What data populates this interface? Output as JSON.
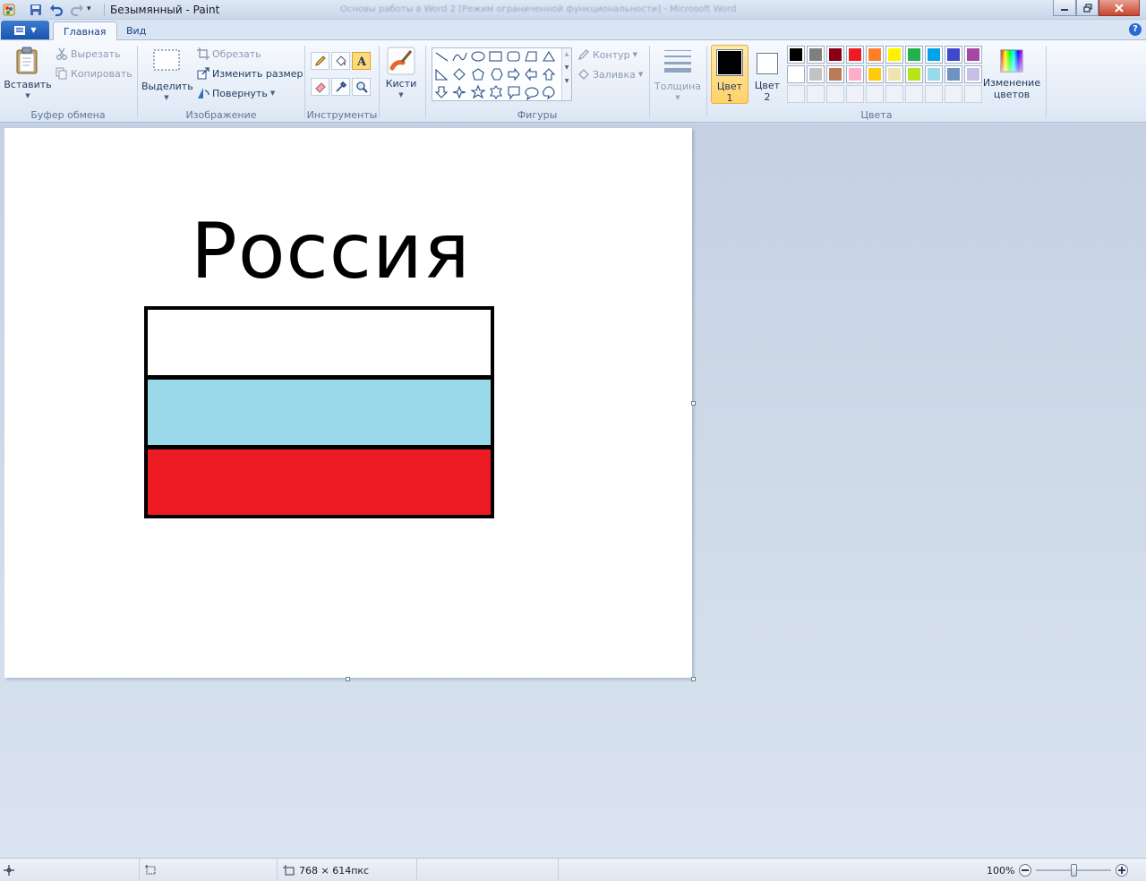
{
  "window": {
    "title": "Безымянный - Paint",
    "background_title": "Основы работы в Word 2 [Режим ограниченной функциональности] - Microsoft Word"
  },
  "tabs": [
    {
      "label": "Главная",
      "active": true
    },
    {
      "label": "Вид",
      "active": false
    }
  ],
  "clipboard": {
    "paste": "Вставить",
    "cut": "Вырезать",
    "copy": "Копировать",
    "group": "Буфер обмена"
  },
  "image": {
    "select": "Выделить",
    "crop": "Обрезать",
    "resize": "Изменить размер",
    "rotate": "Повернуть",
    "group": "Изображение"
  },
  "tools": {
    "group": "Инструменты",
    "brushes": "Кисти"
  },
  "shapes": {
    "outline": "Контур",
    "fill": "Заливка",
    "group": "Фигуры"
  },
  "size": {
    "label": "Толщина"
  },
  "colors": {
    "color1_line1": "Цвет",
    "color1_line2": "1",
    "color2_line1": "Цвет",
    "color2_line2": "2",
    "edit_line1": "Изменение",
    "edit_line2": "цветов",
    "group": "Цвета",
    "color1": "#000000",
    "color2": "#ffffff",
    "palette_row1": [
      "#000000",
      "#7f7f7f",
      "#880015",
      "#ed1c24",
      "#ff7f27",
      "#fff200",
      "#22b14c",
      "#00a2e8",
      "#3f48cc",
      "#a349a4"
    ],
    "palette_row2": [
      "#ffffff",
      "#c3c3c3",
      "#b97a57",
      "#ffaec9",
      "#ffc90e",
      "#efe4b0",
      "#b5e61d",
      "#99d9ea",
      "#7092be",
      "#c8bfe7"
    ]
  },
  "canvas": {
    "title_text": "Россия",
    "flag_colors": [
      "#ffffff",
      "#99d9ea",
      "#ed1c24"
    ]
  },
  "status": {
    "dimensions": "768 × 614пкс",
    "zoom": "100%"
  }
}
